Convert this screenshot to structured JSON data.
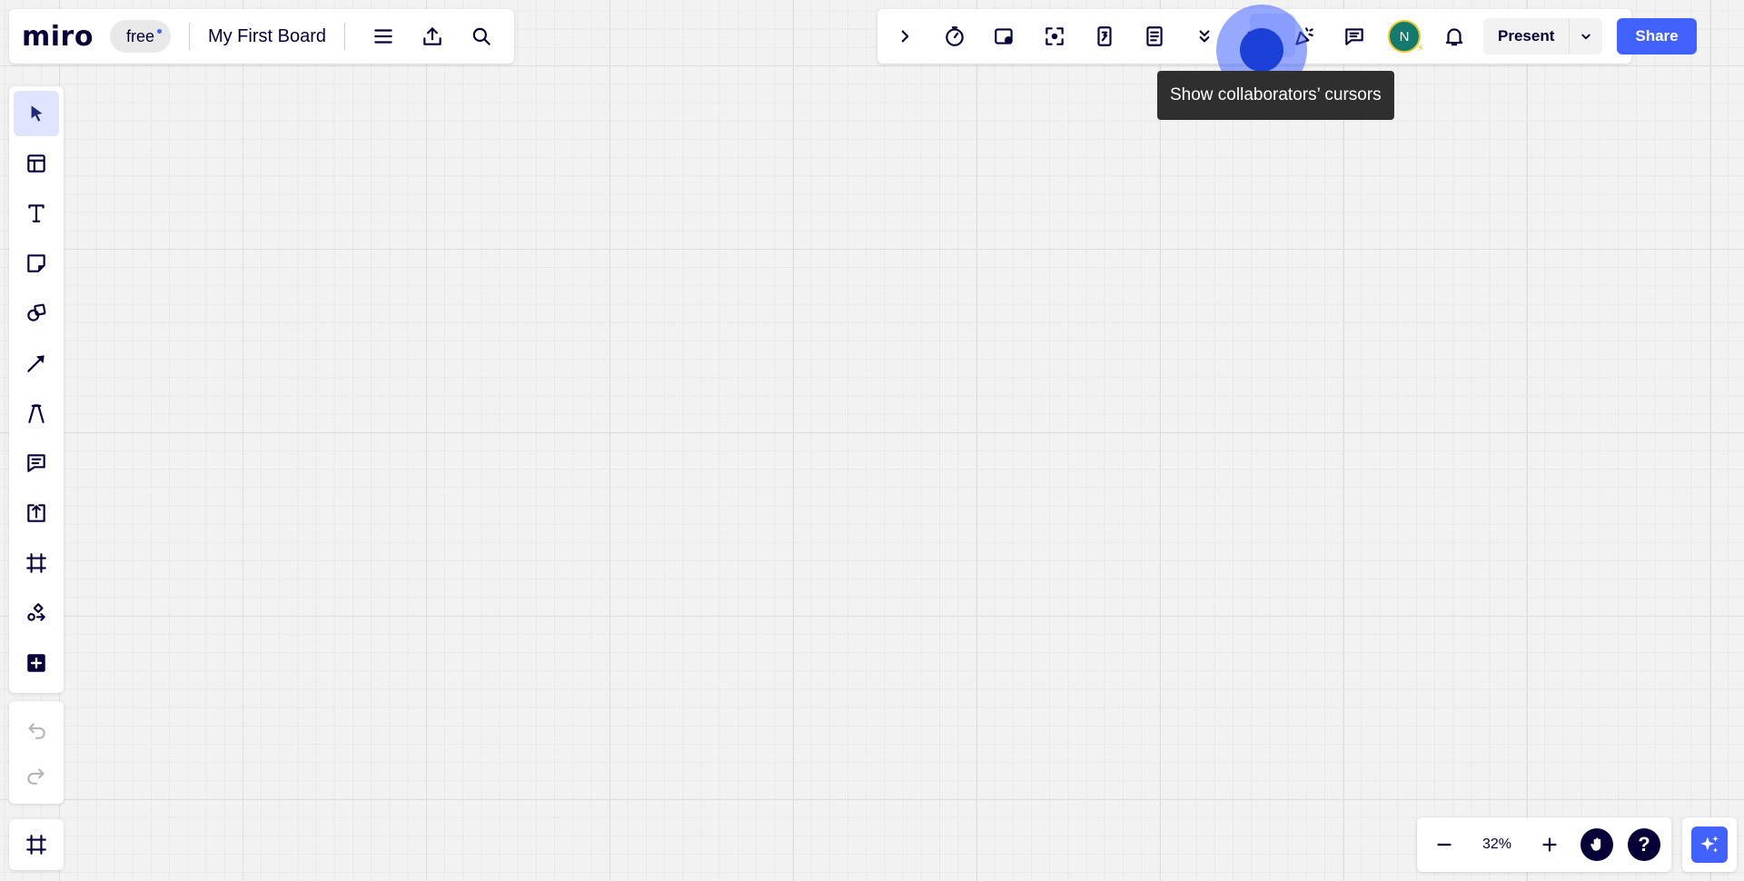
{
  "app": {
    "logo": "miro",
    "plan_badge": "free",
    "board_title": "My First Board"
  },
  "top_right": {
    "avatar_initial": "N",
    "present_label": "Present",
    "share_label": "Share"
  },
  "tooltip": {
    "text": "Show collaborators’ cursors"
  },
  "zoom": {
    "level": "32%"
  },
  "help": {
    "label": "?"
  },
  "colors": {
    "accent": "#4262ff",
    "canvas": "#f2f2f2",
    "tooltip_bg": "#2f2f2f",
    "avatar_bg": "#147a6e"
  },
  "icons": {
    "top_left": [
      "menu-icon",
      "export-icon",
      "search-icon"
    ],
    "top_right": [
      "expand-chevron-icon",
      "timer-icon",
      "voting-icon",
      "focus-icon",
      "card-icon",
      "notes-icon",
      "more-icon",
      "cursors-icon",
      "reactions-icon",
      "comments-icon",
      "avatar",
      "bell-icon"
    ],
    "left_toolbar": [
      "select-icon",
      "templates-icon",
      "text-icon",
      "sticky-note-icon",
      "shapes-icon",
      "arrow-icon",
      "pen-icon",
      "comment-icon",
      "upload-icon",
      "frame-icon",
      "diagram-icon",
      "add-apps-icon"
    ],
    "history": [
      "undo-icon",
      "redo-icon"
    ]
  }
}
